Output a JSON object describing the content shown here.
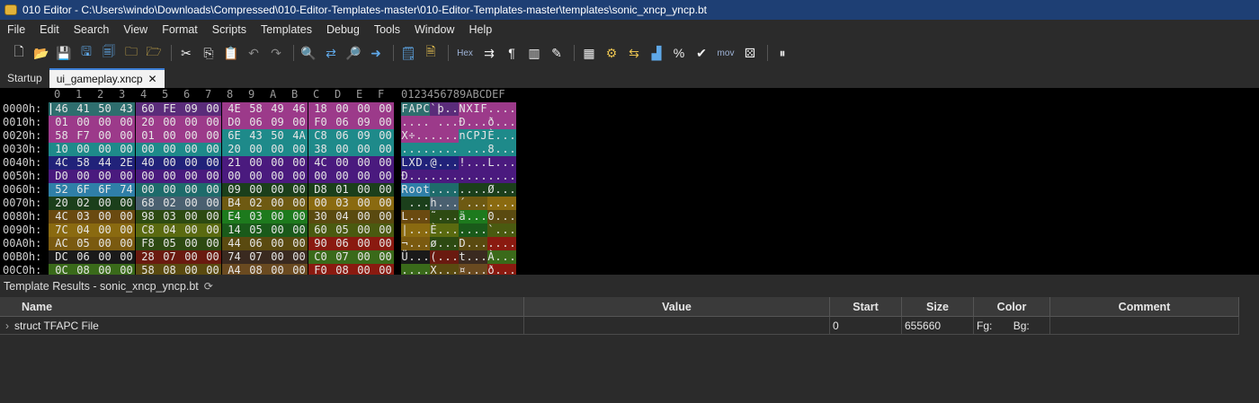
{
  "window": {
    "title": "010 Editor - C:\\Users\\windo\\Downloads\\Compressed\\010-Editor-Templates-master\\010-Editor-Templates-master\\templates\\sonic_xncp_yncp.bt"
  },
  "menu": [
    "File",
    "Edit",
    "Search",
    "View",
    "Format",
    "Scripts",
    "Templates",
    "Debug",
    "Tools",
    "Window",
    "Help"
  ],
  "toolbar": {
    "hex_label": "Hex",
    "mov_label": "mov"
  },
  "tabs": [
    {
      "label": "Startup",
      "active": false
    },
    {
      "label": "ui_gameplay.xncp",
      "active": true,
      "close": "✕"
    }
  ],
  "hex": {
    "col_headers": [
      "0",
      "1",
      "2",
      "3",
      "4",
      "5",
      "6",
      "7",
      "8",
      "9",
      "A",
      "B",
      "C",
      "D",
      "E",
      "F"
    ],
    "ascii_header": "0123456789ABCDEF",
    "rows": [
      {
        "addr": "0000h:",
        "bytes": [
          "46",
          "41",
          "50",
          "43",
          "60",
          "FE",
          "09",
          "00",
          "4E",
          "58",
          "49",
          "46",
          "18",
          "00",
          "00",
          "00"
        ],
        "ascii": "FAPC`þ..NXIF...."
      },
      {
        "addr": "0010h:",
        "bytes": [
          "01",
          "00",
          "00",
          "00",
          "20",
          "00",
          "00",
          "00",
          "D0",
          "06",
          "09",
          "00",
          "F0",
          "06",
          "09",
          "00"
        ],
        "ascii": ".... ...Ð...ð..."
      },
      {
        "addr": "0020h:",
        "bytes": [
          "58",
          "F7",
          "00",
          "00",
          "01",
          "00",
          "00",
          "00",
          "6E",
          "43",
          "50",
          "4A",
          "C8",
          "06",
          "09",
          "00"
        ],
        "ascii": "X÷......nCPJÈ..."
      },
      {
        "addr": "0030h:",
        "bytes": [
          "10",
          "00",
          "00",
          "00",
          "00",
          "00",
          "00",
          "00",
          "20",
          "00",
          "00",
          "00",
          "38",
          "00",
          "00",
          "00"
        ],
        "ascii": "........ ...8..."
      },
      {
        "addr": "0040h:",
        "bytes": [
          "4C",
          "58",
          "44",
          "2E",
          "40",
          "00",
          "00",
          "00",
          "21",
          "00",
          "00",
          "00",
          "4C",
          "00",
          "00",
          "00"
        ],
        "ascii": "LXD.@...!...L..."
      },
      {
        "addr": "0050h:",
        "bytes": [
          "D0",
          "00",
          "00",
          "00",
          "00",
          "00",
          "00",
          "00",
          "00",
          "00",
          "00",
          "00",
          "00",
          "00",
          "00",
          "00"
        ],
        "ascii": "Ð..............."
      },
      {
        "addr": "0060h:",
        "bytes": [
          "52",
          "6F",
          "6F",
          "74",
          "00",
          "00",
          "00",
          "00",
          "09",
          "00",
          "00",
          "00",
          "D8",
          "01",
          "00",
          "00"
        ],
        "ascii": "Root........Ø..."
      },
      {
        "addr": "0070h:",
        "bytes": [
          "20",
          "02",
          "00",
          "00",
          "68",
          "02",
          "00",
          "00",
          "B4",
          "02",
          "00",
          "00",
          "00",
          "03",
          "00",
          "00"
        ],
        "ascii": " ...h...´......."
      },
      {
        "addr": "0080h:",
        "bytes": [
          "4C",
          "03",
          "00",
          "00",
          "98",
          "03",
          "00",
          "00",
          "E4",
          "03",
          "00",
          "00",
          "30",
          "04",
          "00",
          "00"
        ],
        "ascii": "L...˜...ä...0..."
      },
      {
        "addr": "0090h:",
        "bytes": [
          "7C",
          "04",
          "00",
          "00",
          "C8",
          "04",
          "00",
          "00",
          "14",
          "05",
          "00",
          "00",
          "60",
          "05",
          "00",
          "00"
        ],
        "ascii": "|...È.......`..."
      },
      {
        "addr": "00A0h:",
        "bytes": [
          "AC",
          "05",
          "00",
          "00",
          "F8",
          "05",
          "00",
          "00",
          "44",
          "06",
          "00",
          "00",
          "90",
          "06",
          "00",
          "00"
        ],
        "ascii": "¬...ø...D......."
      },
      {
        "addr": "00B0h:",
        "bytes": [
          "DC",
          "06",
          "00",
          "00",
          "28",
          "07",
          "00",
          "00",
          "74",
          "07",
          "00",
          "00",
          "C0",
          "07",
          "00",
          "00"
        ],
        "ascii": "Ü...(...t...À..."
      },
      {
        "addr": "00C0h:",
        "bytes": [
          "0C",
          "08",
          "00",
          "00",
          "58",
          "08",
          "00",
          "00",
          "A4",
          "08",
          "00",
          "00",
          "F0",
          "08",
          "00",
          "00"
        ],
        "ascii": "....X...¤...ð..."
      }
    ],
    "row_colors": [
      [
        "#2e6e6e",
        "#2e6e6e",
        "#2e6e6e",
        "#2e6e6e",
        "#5a2c7a",
        "#5a2c7a",
        "#5a2c7a",
        "#5a2c7a",
        "#9c3a8a",
        "#9c3a8a",
        "#9c3a8a",
        "#9c3a8a",
        "#9c3a8a",
        "#9c3a8a",
        "#9c3a8a",
        "#9c3a8a"
      ],
      [
        "#9c3a8a",
        "#9c3a8a",
        "#9c3a8a",
        "#9c3a8a",
        "#9c3a8a",
        "#9c3a8a",
        "#9c3a8a",
        "#9c3a8a",
        "#9c3a8a",
        "#9c3a8a",
        "#9c3a8a",
        "#9c3a8a",
        "#9c3a8a",
        "#9c3a8a",
        "#9c3a8a",
        "#9c3a8a"
      ],
      [
        "#9c3a8a",
        "#9c3a8a",
        "#9c3a8a",
        "#9c3a8a",
        "#9c3a8a",
        "#9c3a8a",
        "#9c3a8a",
        "#9c3a8a",
        "#1e8a8a",
        "#1e8a8a",
        "#1e8a8a",
        "#1e8a8a",
        "#1e8a8a",
        "#1e8a8a",
        "#1e8a8a",
        "#1e8a8a"
      ],
      [
        "#1e8a8a",
        "#1e8a8a",
        "#1e8a8a",
        "#1e8a8a",
        "#1e8a8a",
        "#1e8a8a",
        "#1e8a8a",
        "#1e8a8a",
        "#1e8a8a",
        "#1e8a8a",
        "#1e8a8a",
        "#1e8a8a",
        "#1e8a8a",
        "#1e8a8a",
        "#1e8a8a",
        "#1e8a8a"
      ],
      [
        "#21227a",
        "#21227a",
        "#21227a",
        "#21227a",
        "#21227a",
        "#21227a",
        "#21227a",
        "#21227a",
        "#4a1a7e",
        "#4a1a7e",
        "#4a1a7e",
        "#4a1a7e",
        "#4a1a7e",
        "#4a1a7e",
        "#4a1a7e",
        "#4a1a7e"
      ],
      [
        "#4a1a7e",
        "#4a1a7e",
        "#4a1a7e",
        "#4a1a7e",
        "#4a1a7e",
        "#4a1a7e",
        "#4a1a7e",
        "#4a1a7e",
        "#4a1a7e",
        "#4a1a7e",
        "#4a1a7e",
        "#4a1a7e",
        "#4a1a7e",
        "#4a1a7e",
        "#4a1a7e",
        "#4a1a7e"
      ],
      [
        "#2f7fa8",
        "#2f7fa8",
        "#2f7fa8",
        "#2f7fa8",
        "#1e6b6b",
        "#1e6b6b",
        "#1e6b6b",
        "#1e6b6b",
        "#1b3f1b",
        "#1b3f1b",
        "#1b3f1b",
        "#1b3f1b",
        "#1b3f1b",
        "#1b3f1b",
        "#1b3f1b",
        "#1b3f1b"
      ],
      [
        "#1b3f1b",
        "#1b3f1b",
        "#1b3f1b",
        "#1b3f1b",
        "#4a6070",
        "#4a6070",
        "#4a6070",
        "#4a6070",
        "#6e5a12",
        "#6e5a12",
        "#6e5a12",
        "#6e5a12",
        "#8a6a10",
        "#8a6a10",
        "#8a6a10",
        "#8a6a10"
      ],
      [
        "#6a4a10",
        "#6a4a10",
        "#6a4a10",
        "#6a4a10",
        "#2d4a12",
        "#2d4a12",
        "#2d4a12",
        "#2d4a12",
        "#1d7a1d",
        "#1d7a1d",
        "#1d7a1d",
        "#1d7a1d",
        "#5a4a10",
        "#5a4a10",
        "#5a4a10",
        "#5a4a10"
      ],
      [
        "#8a6a10",
        "#8a6a10",
        "#8a6a10",
        "#8a6a10",
        "#5a6a10",
        "#5a6a10",
        "#5a6a10",
        "#5a6a10",
        "#1a5a1a",
        "#1a5a1a",
        "#1a5a1a",
        "#1a5a1a",
        "#4a5a10",
        "#4a5a10",
        "#4a5a10",
        "#4a5a10"
      ],
      [
        "#7a5a10",
        "#7a5a10",
        "#7a5a10",
        "#7a5a10",
        "#2d4a12",
        "#2d4a12",
        "#2d4a12",
        "#2d4a12",
        "#5a4a10",
        "#5a4a10",
        "#5a4a10",
        "#5a4a10",
        "#8a1a10",
        "#8a1a10",
        "#8a1a10",
        "#8a1a10"
      ],
      [
        "#1a1a1a",
        "#1a1a1a",
        "#1a1a1a",
        "#1a1a1a",
        "#6a1a10",
        "#6a1a10",
        "#6a1a10",
        "#6a1a10",
        "#3a2a20",
        "#3a2a20",
        "#3a2a20",
        "#3a2a20",
        "#3a6a1a",
        "#3a6a1a",
        "#3a6a1a",
        "#3a6a1a"
      ],
      [
        "#3a6a1a",
        "#3a6a1a",
        "#3a6a1a",
        "#3a6a1a",
        "#5a4a10",
        "#5a4a10",
        "#5a4a10",
        "#5a4a10",
        "#6a4a20",
        "#6a4a20",
        "#6a4a20",
        "#6a4a20",
        "#8a1a10",
        "#8a1a10",
        "#8a1a10",
        "#8a1a10"
      ]
    ]
  },
  "template_results": {
    "title": "Template Results - sonic_xncp_yncp.bt",
    "columns": [
      "Name",
      "Value",
      "Start",
      "Size",
      "Color",
      "Comment"
    ],
    "rows": [
      {
        "name": "struct TFAPC File",
        "value": "",
        "start": "0",
        "size": "655660",
        "fg": "Fg:",
        "bg": "Bg:",
        "comment": ""
      }
    ]
  }
}
